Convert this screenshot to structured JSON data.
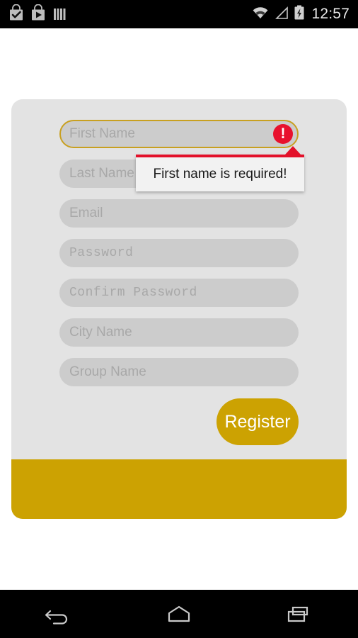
{
  "status_bar": {
    "icons": [
      "play-store-bag-check-icon",
      "play-store-bag-play-icon",
      "bars-icon"
    ],
    "right_icons": [
      "wifi-icon",
      "signal-triangle-icon",
      "battery-charging-icon"
    ],
    "clock": "12:57",
    "background_color": "#000000",
    "text_color": "#e8e8e8"
  },
  "card": {
    "background_color": "#e3e3e3",
    "footer_color": "#cca202",
    "field_color": "#cccccc",
    "placeholder_color": "#a8a8a8",
    "accent_color": "#cca202",
    "focus_border_color": "#c8a021",
    "error_color": "#e3112a"
  },
  "form": {
    "fields": [
      {
        "name": "first-name",
        "placeholder": "First Name",
        "value": "",
        "mono": false,
        "focused": true,
        "has_error": true
      },
      {
        "name": "last-name",
        "placeholder": "Last Name",
        "value": "",
        "mono": false,
        "focused": false,
        "has_error": false
      },
      {
        "name": "email",
        "placeholder": "Email",
        "value": "",
        "mono": false,
        "focused": false,
        "has_error": false
      },
      {
        "name": "password",
        "placeholder": "Password",
        "value": "",
        "mono": true,
        "focused": false,
        "has_error": false
      },
      {
        "name": "confirm-password",
        "placeholder": "Confirm Password",
        "value": "",
        "mono": true,
        "focused": false,
        "has_error": false
      },
      {
        "name": "city-name",
        "placeholder": "City Name",
        "value": "",
        "mono": false,
        "focused": false,
        "has_error": false
      },
      {
        "name": "group-name",
        "placeholder": "Group Name",
        "value": "",
        "mono": false,
        "focused": false,
        "has_error": false
      }
    ],
    "error_tooltip": {
      "message": "First name is required!",
      "icon": "error-exclamation-icon",
      "badge_glyph": "!"
    },
    "submit_label": "Register"
  },
  "nav_bar": {
    "buttons": [
      {
        "name": "back-icon",
        "label": "Back"
      },
      {
        "name": "home-icon",
        "label": "Home"
      },
      {
        "name": "recents-icon",
        "label": "Recents"
      }
    ],
    "background_color": "#000000"
  }
}
